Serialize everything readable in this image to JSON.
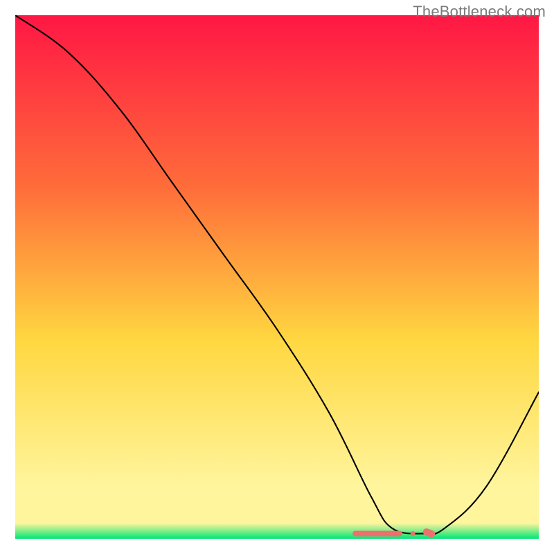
{
  "watermark": "TheBottleneck.com",
  "chart_data": {
    "type": "line",
    "title": "",
    "xlabel": "",
    "ylabel": "",
    "xlim": [
      0,
      100
    ],
    "ylim": [
      0,
      100
    ],
    "grid": false,
    "legend": false,
    "series": [
      {
        "name": "bottleneck-curve",
        "x": [
          0,
          10,
          20,
          30,
          40,
          50,
          60,
          68,
          72,
          78,
          82,
          90,
          100
        ],
        "values": [
          100,
          93,
          82,
          68,
          54,
          40,
          24,
          8,
          2,
          1,
          2,
          10,
          28
        ]
      }
    ],
    "annotations": [
      {
        "name": "optimal-marker",
        "x": 77,
        "y": 1
      }
    ],
    "background_gradient": {
      "top": "#ff1744",
      "mid_top": "#ff6d3a",
      "mid": "#ffd740",
      "mid_bottom": "#fff59d",
      "bottom": "#00e676"
    },
    "marker_color": "#ef6f6f"
  }
}
